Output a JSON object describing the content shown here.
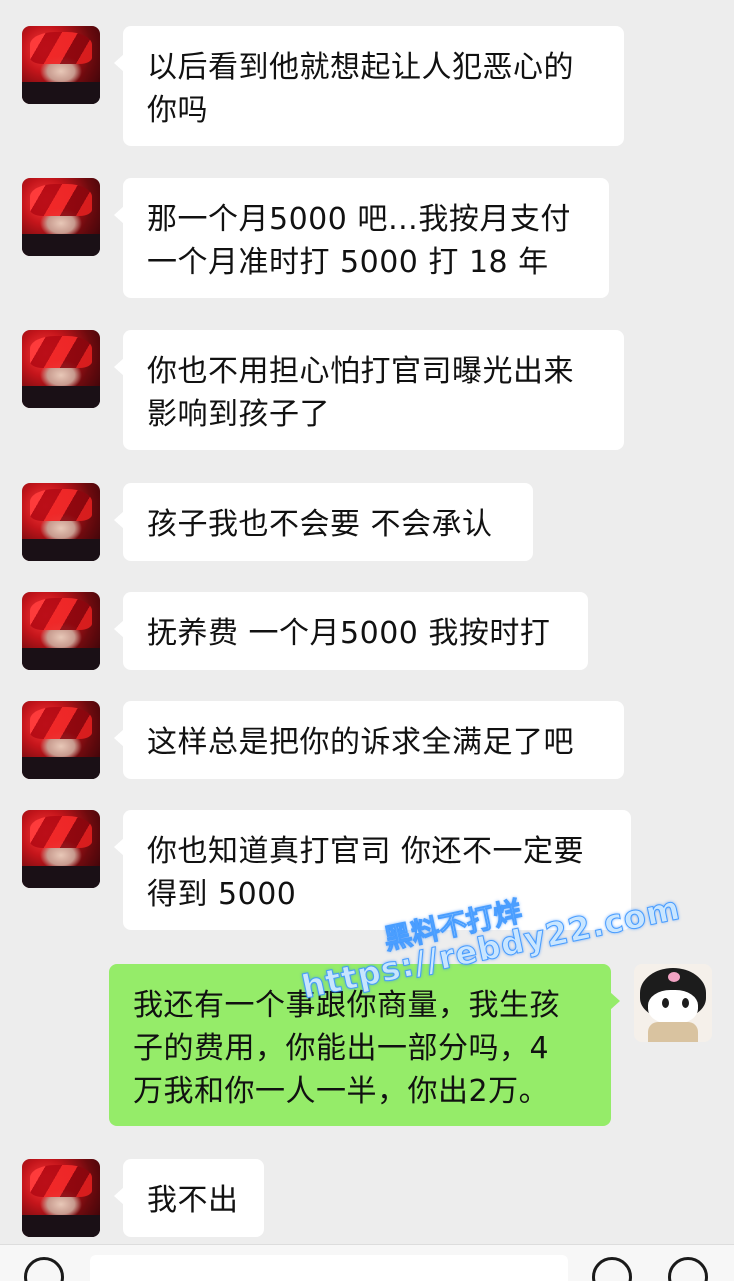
{
  "messages": [
    {
      "side": "left",
      "lines": [
        "以后看到他就想起让人犯恶心的",
        "你吗"
      ]
    },
    {
      "side": "left",
      "lines": [
        "那一个月5000 吧…我按月支付",
        "一个月准时打 5000 打 18 年"
      ]
    },
    {
      "side": "left",
      "lines": [
        "你也不用担心怕打官司曝光出来",
        "影响到孩子了"
      ]
    },
    {
      "side": "left",
      "lines": [
        "孩子我也不会要 不会承认"
      ]
    },
    {
      "side": "left",
      "lines": [
        "抚养费 一个月5000 我按时打"
      ]
    },
    {
      "side": "left",
      "lines": [
        "这样总是把你的诉求全满足了吧"
      ]
    },
    {
      "side": "left",
      "lines": [
        "你也知道真打官司 你还不一定要",
        "得到 5000"
      ]
    },
    {
      "side": "right",
      "lines": [
        "我还有一个事跟你商量，我生孩",
        "子的费用，你能出一部分吗，4",
        "万我和你一人一半，你出2万。"
      ]
    },
    {
      "side": "left",
      "lines": [
        "我不出"
      ]
    }
  ],
  "watermark": {
    "line1": "黑料不打烊",
    "line2": "https://rebdy22.com"
  },
  "colors": {
    "background": "#ededed",
    "bubble_left": "#ffffff",
    "bubble_right": "#95ec69"
  },
  "icons": {
    "left_avatar": "red-haired-anime-avatar",
    "right_avatar": "kuromi-avatar",
    "voice": "voice-icon",
    "emoji": "emoji-icon",
    "more": "plus-icon"
  }
}
